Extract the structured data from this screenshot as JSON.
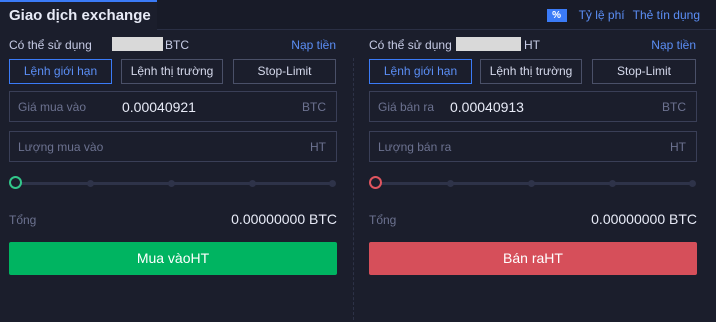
{
  "header": {
    "title": "Giao dịch exchange",
    "pct_icon_text": "%",
    "fee_link": "Tỷ lệ phí",
    "credit_card_link": "Thẻ tín dụng"
  },
  "buy": {
    "available_label": "Có thể sử dụng",
    "available_unit": "BTC",
    "deposit_link": "Nạp tiền",
    "tabs": [
      "Lệnh giới hạn",
      "Lệnh thị trường",
      "Stop-Limit"
    ],
    "active_tab": 0,
    "price_label": "Giá mua vào",
    "price_value": "0.00040921",
    "price_unit": "BTC",
    "amount_placeholder": "Lượng mua vào",
    "amount_unit": "HT",
    "slider_level": 0,
    "total_label": "Tổng",
    "total_value": "0.00000000 BTC",
    "button_label": "Mua vàoHT",
    "accent_color": "#00b461"
  },
  "sell": {
    "available_label": "Có thể sử dụng",
    "available_unit": "HT",
    "deposit_link": "Nạp tiền",
    "tabs": [
      "Lệnh giới hạn",
      "Lệnh thị trường",
      "Stop-Limit"
    ],
    "active_tab": 0,
    "price_label": "Giá bán ra",
    "price_value": "0.00040913",
    "price_unit": "BTC",
    "amount_placeholder": "Lượng bán ra",
    "amount_unit": "HT",
    "slider_level": 0,
    "total_label": "Tổng",
    "total_value": "0.00000000 BTC",
    "button_label": "Bán raHT",
    "accent_color": "#d64f5a"
  }
}
